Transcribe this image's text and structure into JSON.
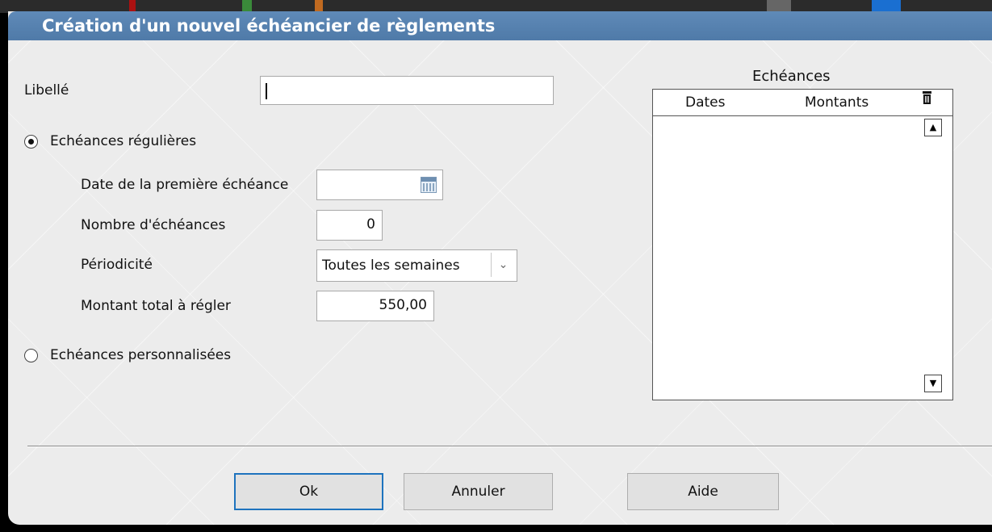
{
  "dialog": {
    "title": "Création d'un nouvel échéancier de règlements"
  },
  "form": {
    "libelle_label": "Libellé",
    "libelle_value": "",
    "regular_option_label": "Echéances régulières",
    "regular_selected": true,
    "first_date_label": "Date de la première échéance",
    "first_date_value": "",
    "count_label": "Nombre d'échéances",
    "count_value": "0",
    "periodicity_label": "Périodicité",
    "periodicity_value": "Toutes les semaines",
    "total_label": "Montant total à régler",
    "total_value": "550,00",
    "custom_option_label": "Echéances personnalisées",
    "custom_selected": false
  },
  "schedule": {
    "title": "Echéances",
    "columns": [
      "Dates",
      "Montants"
    ],
    "rows": []
  },
  "buttons": {
    "ok": "Ok",
    "cancel": "Annuler",
    "help": "Aide"
  },
  "colors": {
    "titlebar": "#5580ad",
    "default_button_border": "#1e73be"
  }
}
